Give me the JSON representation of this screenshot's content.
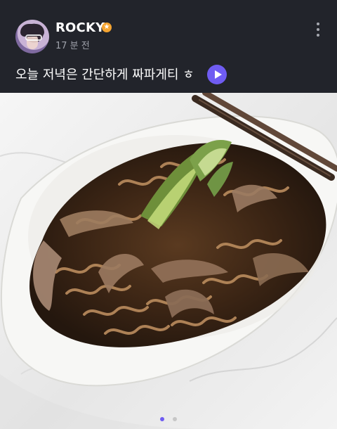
{
  "post": {
    "author": "ROCKY",
    "time_ago": "17 분 전",
    "caption": "오늘 저녁은 간단하게 짜파게티 ㅎ",
    "badge_icon": "star-badge-icon",
    "accent_color": "#6f5cf2",
    "badge_color": "#f5a431"
  },
  "carousel": {
    "page_count": 2,
    "current_page": 1
  }
}
